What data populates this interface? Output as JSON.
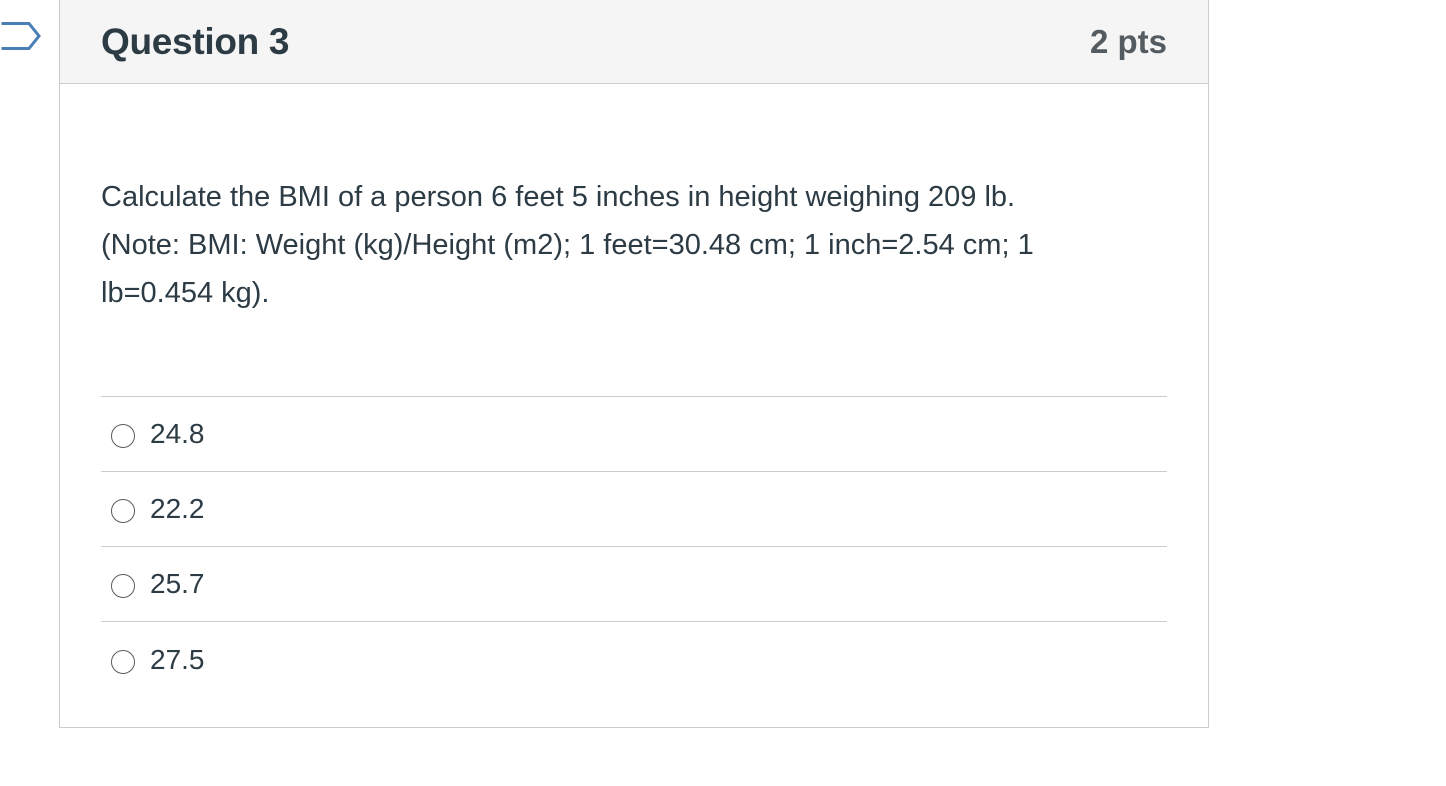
{
  "question": {
    "title": "Question 3",
    "points": "2 pts",
    "text_lines": [
      "Calculate the BMI of a person 6 feet 5 inches in height weighing 209 lb.",
      "(Note: BMI: Weight (kg)/Height (m2); 1 feet=30.48 cm; 1 inch=2.54 cm; 1",
      "lb=0.454 kg)."
    ]
  },
  "answers": [
    {
      "label": "24.8",
      "selected": false
    },
    {
      "label": "22.2",
      "selected": false
    },
    {
      "label": "25.7",
      "selected": false
    },
    {
      "label": "27.5",
      "selected": false
    }
  ],
  "colors": {
    "header_bg": "#f5f5f5",
    "border": "#c7cdd1",
    "text": "#2d3b45",
    "flag": "#4a7fb5"
  },
  "icons": {
    "flag": "bookmark-flag-icon",
    "radio": "radio-unchecked-icon"
  }
}
